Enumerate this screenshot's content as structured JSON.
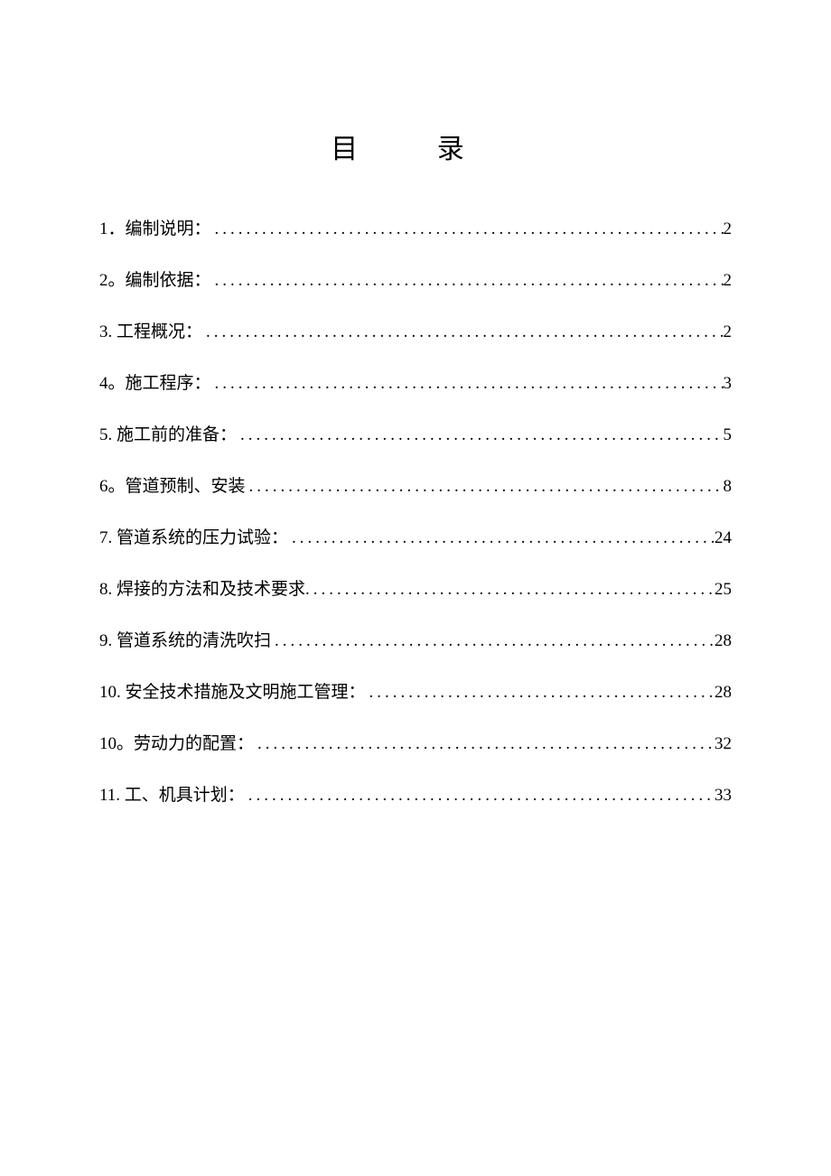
{
  "title": "目  录",
  "toc": [
    {
      "label": "1．编制说明：",
      "page": "2"
    },
    {
      "label": "2。编制依据：",
      "page": "2"
    },
    {
      "label": "3.  工程概况：",
      "page": "2"
    },
    {
      "label": "4。施工程序：",
      "page": "3"
    },
    {
      "label": "5.  施工前的准备：",
      "page": "5"
    },
    {
      "label": "6。管道预制、安装",
      "page": "8"
    },
    {
      "label": "7.  管道系统的压力试验：",
      "page": "24"
    },
    {
      "label": "8.  焊接的方法和及技术要求.",
      "page": "25"
    },
    {
      "label": "9.  管道系统的清洗吹扫",
      "page": "28"
    },
    {
      "label": "10. 安全技术措施及文明施工管理：",
      "page": "28"
    },
    {
      "label": "10。劳动力的配置：",
      "page": "32"
    },
    {
      "label": "11. 工、机具计划：",
      "page": "33"
    }
  ]
}
